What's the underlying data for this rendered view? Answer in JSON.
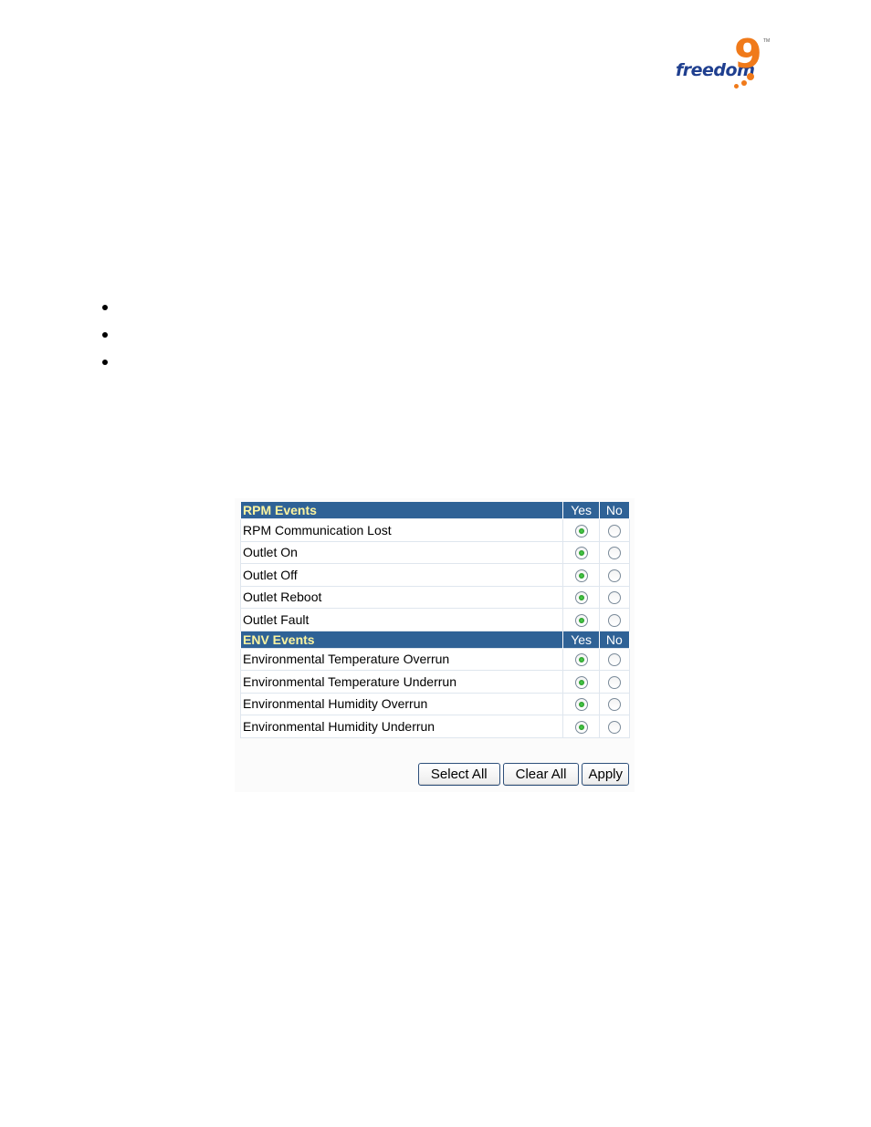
{
  "logo": {
    "text": "freedom",
    "numeral": "9",
    "trademark": "TM",
    "brand_colors": {
      "text": "#1f3f8f",
      "accent": "#f07a1a"
    }
  },
  "bullets": [
    "",
    "",
    ""
  ],
  "rpm_section": {
    "title": "RPM Events",
    "yes_label": "Yes",
    "no_label": "No",
    "rows": [
      {
        "label": "RPM Communication Lost",
        "value": "yes"
      },
      {
        "label": "Outlet On",
        "value": "yes"
      },
      {
        "label": "Outlet Off",
        "value": "yes"
      },
      {
        "label": "Outlet Reboot",
        "value": "yes"
      },
      {
        "label": "Outlet Fault",
        "value": "yes"
      }
    ]
  },
  "env_section": {
    "title": "ENV Events",
    "yes_label": "Yes",
    "no_label": "No",
    "rows": [
      {
        "label": "Environmental Temperature Overrun",
        "value": "yes"
      },
      {
        "label": "Environmental Temperature Underrun",
        "value": "yes"
      },
      {
        "label": "Environmental Humidity Overrun",
        "value": "yes"
      },
      {
        "label": "Environmental Humidity Underrun",
        "value": "yes"
      }
    ]
  },
  "buttons": {
    "select_all": "Select All",
    "clear_all": "Clear All",
    "apply": "Apply"
  },
  "colors": {
    "header_bg": "#2f6296",
    "header_title": "#fcf4a0",
    "radio_selected": "#2fae2f"
  }
}
